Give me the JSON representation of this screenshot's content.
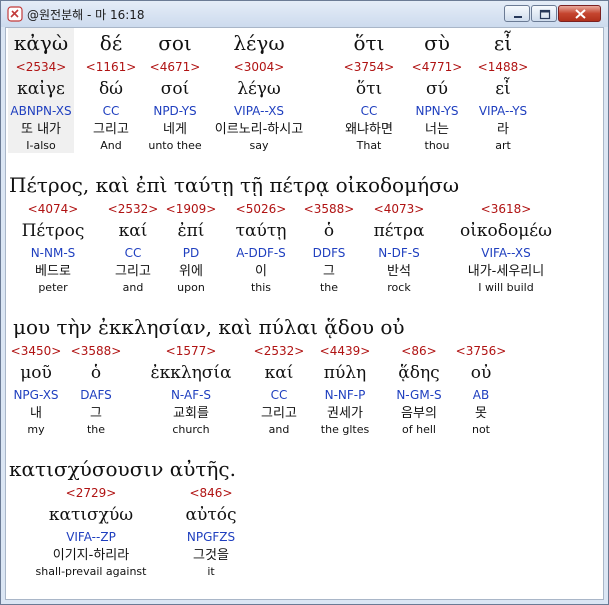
{
  "window": {
    "title": "@원전분해 - 마 16:18",
    "minimize_label": "minimize",
    "maximize_label": "maximize",
    "close_label": "close"
  },
  "verse_lines": [
    "Πέτρος, καὶ ἐπὶ ταύτῃ τῇ πέτρᾳ οἰκοδομήσω",
    "μου τὴν ἐκκλησίαν, καὶ πύλαι ᾅδου οὐ",
    "κατισχύσουσιν αὐτῆς."
  ],
  "words": [
    {
      "greek": "κἀγὼ",
      "strong": "<2534>",
      "lemma": "καἰγε",
      "parse": "ABNPN-XS",
      "korean": "또 내가",
      "english": "I-also"
    },
    {
      "greek": "δέ",
      "strong": "<1161>",
      "lemma": "δώ",
      "parse": "CC",
      "korean": "그리고",
      "english": "And"
    },
    {
      "greek": "σοι",
      "strong": "<4671>",
      "lemma": "σοί",
      "parse": "NPD-YS",
      "korean": "네게",
      "english": "unto thee"
    },
    {
      "greek": "λέγω",
      "strong": "<3004>",
      "lemma": "λέγω",
      "parse": "VIPA--XS",
      "korean": "이르노리-하시고",
      "english": "say"
    },
    {
      "greek": "ὅτι",
      "strong": "<3754>",
      "lemma": "ὅτι",
      "parse": "CC",
      "korean": "왜냐하면",
      "english": "That"
    },
    {
      "greek": "σὺ",
      "strong": "<4771>",
      "lemma": "σύ",
      "parse": "NPN-YS",
      "korean": "너는",
      "english": "thou"
    },
    {
      "greek": "εἶ",
      "strong": "<1488>",
      "lemma": "εἶ",
      "parse": "VIPA--YS",
      "korean": "라",
      "english": "art"
    },
    {
      "greek": "",
      "strong": "<4074>",
      "lemma": "Πέτρος",
      "parse": "N-NM-S",
      "korean": "베드로",
      "english": "peter"
    },
    {
      "greek": "",
      "strong": "<2532>",
      "lemma": "καί",
      "parse": "CC",
      "korean": "그리고",
      "english": "and"
    },
    {
      "greek": "",
      "strong": "<1909>",
      "lemma": "ἐπί",
      "parse": "PD",
      "korean": "위에",
      "english": "upon"
    },
    {
      "greek": "",
      "strong": "<5026>",
      "lemma": "ταύτῃ",
      "parse": "A-DDF-S",
      "korean": "이",
      "english": "this"
    },
    {
      "greek": "",
      "strong": "<3588>",
      "lemma": "ὁ",
      "parse": "DDFS",
      "korean": "그",
      "english": "the"
    },
    {
      "greek": "",
      "strong": "<4073>",
      "lemma": "πέτρα",
      "parse": "N-DF-S",
      "korean": "반석",
      "english": "rock"
    },
    {
      "greek": "",
      "strong": "<3618>",
      "lemma": "οἰκοδομέω",
      "parse": "VIFA--XS",
      "korean": "내가-세우리니",
      "english": "I will build"
    },
    {
      "greek": "",
      "strong": "<3450>",
      "lemma": "μοῦ",
      "parse": "NPG-XS",
      "korean": "내",
      "english": "my"
    },
    {
      "greek": "",
      "strong": "<3588>",
      "lemma": "ὁ",
      "parse": "DAFS",
      "korean": "그",
      "english": "the"
    },
    {
      "greek": "",
      "strong": "<1577>",
      "lemma": "ἐκκλησία",
      "parse": "N-AF-S",
      "korean": "교회를",
      "english": "church"
    },
    {
      "greek": "",
      "strong": "<2532>",
      "lemma": "καί",
      "parse": "CC",
      "korean": "그리고",
      "english": "and"
    },
    {
      "greek": "",
      "strong": "<4439>",
      "lemma": "πύλη",
      "parse": "N-NF-P",
      "korean": "권세가",
      "english": "the gltes"
    },
    {
      "greek": "",
      "strong": "<86>",
      "lemma": "ᾅδης",
      "parse": "N-GM-S",
      "korean": "음부의",
      "english": "of hell"
    },
    {
      "greek": "",
      "strong": "<3756>",
      "lemma": "οὐ",
      "parse": "AB",
      "korean": "못",
      "english": "not"
    },
    {
      "greek": "",
      "strong": "<2729>",
      "lemma": "κατισχύω",
      "parse": "VIFA--ZP",
      "korean": "이기지-하리라",
      "english": "shall-prevail against"
    },
    {
      "greek": "",
      "strong": "<846>",
      "lemma": "αὐτός",
      "parse": "NPGFZS",
      "korean": "그것을",
      "english": "it"
    }
  ]
}
